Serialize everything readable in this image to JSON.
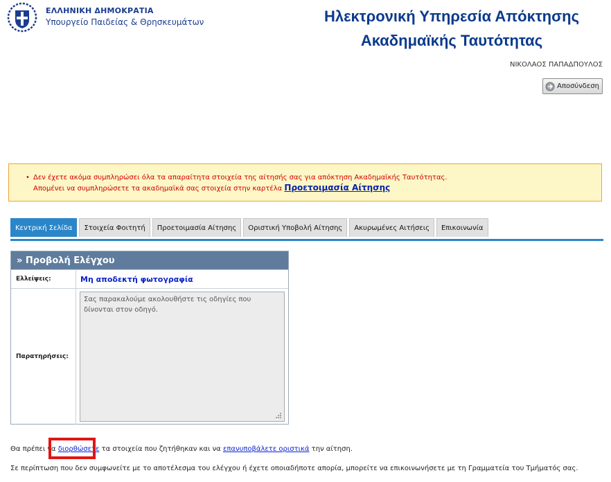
{
  "header": {
    "gov_line1": "ΕΛΛΗΝΙΚΗ ΔΗΜΟΚΡΑΤΙΑ",
    "gov_line2": "Υπουργείο Παιδείας & Θρησκευμάτων",
    "title_line1": "Ηλεκτρονική Υπηρεσία Απόκτησης",
    "title_line2": "Ακαδημαϊκής Ταυτότητας",
    "user_name": "ΝΙΚΟΛΑΟΣ ΠΑΠΑΔΠΟΥΛΟΣ",
    "logout_label": "Αποσύνδεση"
  },
  "alert": {
    "line1": "Δεν έχετε ακόμα συμπληρώσει όλα τα απαραίτητα στοιχεία της αίτησής σας για απόκτηση Ακαδημαϊκής Ταυτότητας.",
    "line2_prefix": "Απομένει να συμπληρώσετε τα ακαδημαϊκά σας στοιχεία στην καρτέλα",
    "line2_link": "Προετοιμασία Αίτησης"
  },
  "tabs": [
    {
      "label": "Κεντρική Σελίδα",
      "active": true
    },
    {
      "label": "Στοιχεία Φοιτητή",
      "active": false
    },
    {
      "label": "Προετοιμασία Αίτησης",
      "active": false
    },
    {
      "label": "Οριστική Υποβολή Αίτησης",
      "active": false
    },
    {
      "label": "Ακυρωμένες Αιτήσεις",
      "active": false
    },
    {
      "label": "Επικοινωνία",
      "active": false
    }
  ],
  "panel": {
    "title": "» Προβολή Ελέγχου",
    "deficiencies_label": "Ελλείψεις:",
    "deficiencies_value": "Μη αποδεκτή φωτογραφία",
    "remarks_label": "Παρατηρήσεις:",
    "remarks_value": "Σας παρακαλούμε ακολουθήστε τις οδηγίες που δίνονται στον οδηγό."
  },
  "footer": {
    "p1_a": "Θα πρέπει να",
    "p1_link1": "διορθώσετε",
    "p1_b": "τα στοιχεία που ζητήθηκαν και να",
    "p1_link2": "επανυποβάλετε οριστικά",
    "p1_c": "την αίτηση.",
    "p2": "Σε περίπτωση που δεν συμφωνείτε με το αποτέλεσμα του ελέγχου ή έχετε οποιαδήποτε απορία, μπορείτε να επικοινωνήσετε με τη Γραμματεία του Τμήματός σας."
  },
  "colors": {
    "brand_blue": "#0a3a8c",
    "tab_active": "#2a86c9",
    "panel_header": "#5f7c9d",
    "alert_bg": "#fdf6c6",
    "alert_text": "#cc0000",
    "highlight": "#e01515"
  }
}
